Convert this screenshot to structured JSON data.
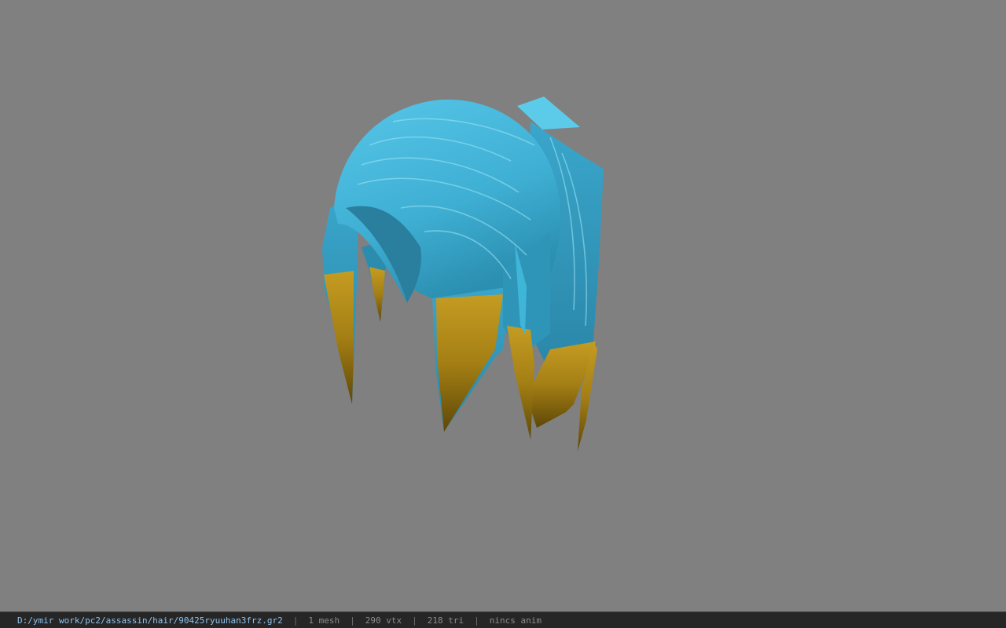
{
  "viewport": {
    "background_color": "#808080",
    "model": {
      "name": "hair-mesh",
      "hair_color": "#4fbfe0",
      "tip_color": "#b8901a"
    }
  },
  "status_bar": {
    "file_path": "D:/ymir work/pc2/assassin/hair/90425ryuuhan3frz.gr2",
    "mesh_count": "1 mesh",
    "vertex_count": "290 vtx",
    "triangle_count": "218 tri",
    "anim_info": "nincs anim",
    "separator": "|",
    "path_color": "#8ec3ee",
    "text_color": "#8c8c8c"
  }
}
